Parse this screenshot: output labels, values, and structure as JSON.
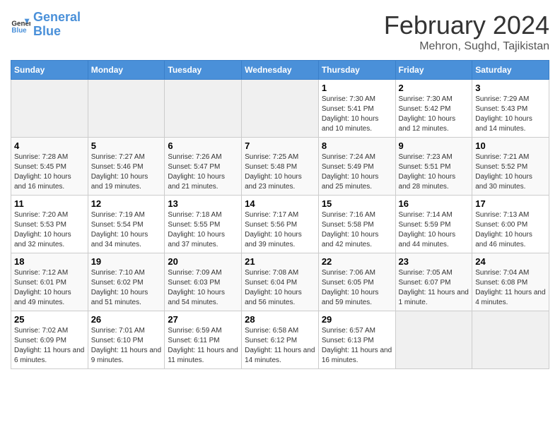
{
  "header": {
    "logo_line1": "General",
    "logo_line2": "Blue",
    "month": "February 2024",
    "location": "Mehron, Sughd, Tajikistan"
  },
  "weekdays": [
    "Sunday",
    "Monday",
    "Tuesday",
    "Wednesday",
    "Thursday",
    "Friday",
    "Saturday"
  ],
  "weeks": [
    [
      {
        "day": "",
        "sunrise": "",
        "sunset": "",
        "daylight": ""
      },
      {
        "day": "",
        "sunrise": "",
        "sunset": "",
        "daylight": ""
      },
      {
        "day": "",
        "sunrise": "",
        "sunset": "",
        "daylight": ""
      },
      {
        "day": "",
        "sunrise": "",
        "sunset": "",
        "daylight": ""
      },
      {
        "day": "1",
        "sunrise": "Sunrise: 7:30 AM",
        "sunset": "Sunset: 5:41 PM",
        "daylight": "Daylight: 10 hours and 10 minutes."
      },
      {
        "day": "2",
        "sunrise": "Sunrise: 7:30 AM",
        "sunset": "Sunset: 5:42 PM",
        "daylight": "Daylight: 10 hours and 12 minutes."
      },
      {
        "day": "3",
        "sunrise": "Sunrise: 7:29 AM",
        "sunset": "Sunset: 5:43 PM",
        "daylight": "Daylight: 10 hours and 14 minutes."
      }
    ],
    [
      {
        "day": "4",
        "sunrise": "Sunrise: 7:28 AM",
        "sunset": "Sunset: 5:45 PM",
        "daylight": "Daylight: 10 hours and 16 minutes."
      },
      {
        "day": "5",
        "sunrise": "Sunrise: 7:27 AM",
        "sunset": "Sunset: 5:46 PM",
        "daylight": "Daylight: 10 hours and 19 minutes."
      },
      {
        "day": "6",
        "sunrise": "Sunrise: 7:26 AM",
        "sunset": "Sunset: 5:47 PM",
        "daylight": "Daylight: 10 hours and 21 minutes."
      },
      {
        "day": "7",
        "sunrise": "Sunrise: 7:25 AM",
        "sunset": "Sunset: 5:48 PM",
        "daylight": "Daylight: 10 hours and 23 minutes."
      },
      {
        "day": "8",
        "sunrise": "Sunrise: 7:24 AM",
        "sunset": "Sunset: 5:49 PM",
        "daylight": "Daylight: 10 hours and 25 minutes."
      },
      {
        "day": "9",
        "sunrise": "Sunrise: 7:23 AM",
        "sunset": "Sunset: 5:51 PM",
        "daylight": "Daylight: 10 hours and 28 minutes."
      },
      {
        "day": "10",
        "sunrise": "Sunrise: 7:21 AM",
        "sunset": "Sunset: 5:52 PM",
        "daylight": "Daylight: 10 hours and 30 minutes."
      }
    ],
    [
      {
        "day": "11",
        "sunrise": "Sunrise: 7:20 AM",
        "sunset": "Sunset: 5:53 PM",
        "daylight": "Daylight: 10 hours and 32 minutes."
      },
      {
        "day": "12",
        "sunrise": "Sunrise: 7:19 AM",
        "sunset": "Sunset: 5:54 PM",
        "daylight": "Daylight: 10 hours and 34 minutes."
      },
      {
        "day": "13",
        "sunrise": "Sunrise: 7:18 AM",
        "sunset": "Sunset: 5:55 PM",
        "daylight": "Daylight: 10 hours and 37 minutes."
      },
      {
        "day": "14",
        "sunrise": "Sunrise: 7:17 AM",
        "sunset": "Sunset: 5:56 PM",
        "daylight": "Daylight: 10 hours and 39 minutes."
      },
      {
        "day": "15",
        "sunrise": "Sunrise: 7:16 AM",
        "sunset": "Sunset: 5:58 PM",
        "daylight": "Daylight: 10 hours and 42 minutes."
      },
      {
        "day": "16",
        "sunrise": "Sunrise: 7:14 AM",
        "sunset": "Sunset: 5:59 PM",
        "daylight": "Daylight: 10 hours and 44 minutes."
      },
      {
        "day": "17",
        "sunrise": "Sunrise: 7:13 AM",
        "sunset": "Sunset: 6:00 PM",
        "daylight": "Daylight: 10 hours and 46 minutes."
      }
    ],
    [
      {
        "day": "18",
        "sunrise": "Sunrise: 7:12 AM",
        "sunset": "Sunset: 6:01 PM",
        "daylight": "Daylight: 10 hours and 49 minutes."
      },
      {
        "day": "19",
        "sunrise": "Sunrise: 7:10 AM",
        "sunset": "Sunset: 6:02 PM",
        "daylight": "Daylight: 10 hours and 51 minutes."
      },
      {
        "day": "20",
        "sunrise": "Sunrise: 7:09 AM",
        "sunset": "Sunset: 6:03 PM",
        "daylight": "Daylight: 10 hours and 54 minutes."
      },
      {
        "day": "21",
        "sunrise": "Sunrise: 7:08 AM",
        "sunset": "Sunset: 6:04 PM",
        "daylight": "Daylight: 10 hours and 56 minutes."
      },
      {
        "day": "22",
        "sunrise": "Sunrise: 7:06 AM",
        "sunset": "Sunset: 6:05 PM",
        "daylight": "Daylight: 10 hours and 59 minutes."
      },
      {
        "day": "23",
        "sunrise": "Sunrise: 7:05 AM",
        "sunset": "Sunset: 6:07 PM",
        "daylight": "Daylight: 11 hours and 1 minute."
      },
      {
        "day": "24",
        "sunrise": "Sunrise: 7:04 AM",
        "sunset": "Sunset: 6:08 PM",
        "daylight": "Daylight: 11 hours and 4 minutes."
      }
    ],
    [
      {
        "day": "25",
        "sunrise": "Sunrise: 7:02 AM",
        "sunset": "Sunset: 6:09 PM",
        "daylight": "Daylight: 11 hours and 6 minutes."
      },
      {
        "day": "26",
        "sunrise": "Sunrise: 7:01 AM",
        "sunset": "Sunset: 6:10 PM",
        "daylight": "Daylight: 11 hours and 9 minutes."
      },
      {
        "day": "27",
        "sunrise": "Sunrise: 6:59 AM",
        "sunset": "Sunset: 6:11 PM",
        "daylight": "Daylight: 11 hours and 11 minutes."
      },
      {
        "day": "28",
        "sunrise": "Sunrise: 6:58 AM",
        "sunset": "Sunset: 6:12 PM",
        "daylight": "Daylight: 11 hours and 14 minutes."
      },
      {
        "day": "29",
        "sunrise": "Sunrise: 6:57 AM",
        "sunset": "Sunset: 6:13 PM",
        "daylight": "Daylight: 11 hours and 16 minutes."
      },
      {
        "day": "",
        "sunrise": "",
        "sunset": "",
        "daylight": ""
      },
      {
        "day": "",
        "sunrise": "",
        "sunset": "",
        "daylight": ""
      }
    ]
  ]
}
